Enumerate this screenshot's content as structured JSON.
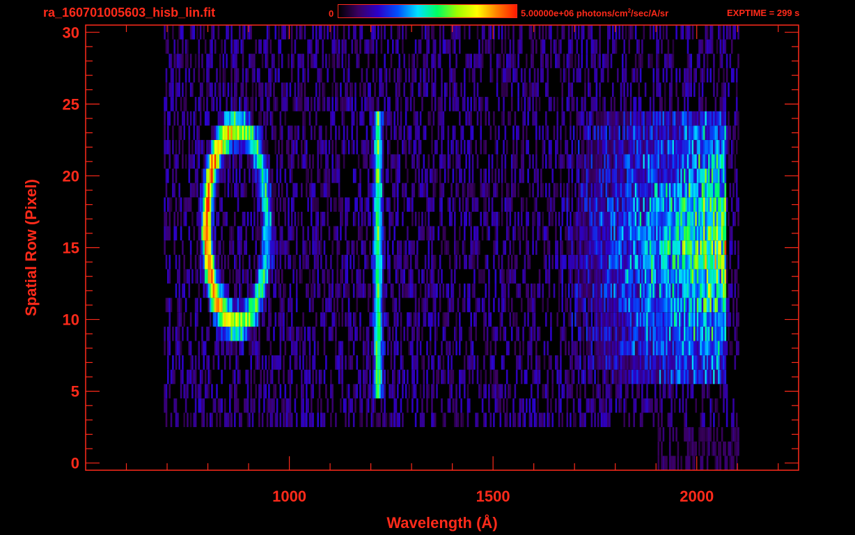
{
  "header": {
    "file_name": "ra_160701005603_hisb_lin.fit",
    "colorbar_min": "0",
    "colorbar_max_prefix": "5.00000e+06 photons/cm",
    "colorbar_max_sup": "2",
    "colorbar_max_suffix": "/sec/A/sr",
    "exptime": "EXPTIME = 299 s"
  },
  "colors": {
    "axis": "#ff2a1a",
    "background": "#000000",
    "colormap": [
      "#000000",
      "#3a0060",
      "#2c00c8",
      "#0050ff",
      "#00e0ff",
      "#00ff60",
      "#a0ff00",
      "#ffff00",
      "#ff8000",
      "#ff1a00"
    ]
  },
  "chart_data": {
    "type": "heatmap",
    "title": "",
    "xlabel": "Wavelength (Å)",
    "ylabel": "Spatial Row (Pixel)",
    "xlim": [
      500,
      2250
    ],
    "ylim": [
      -0.5,
      30.5
    ],
    "x_ticks": [
      1000,
      1500,
      2000
    ],
    "y_ticks": [
      0,
      5,
      10,
      15,
      20,
      25,
      30
    ],
    "colorbar_range": [
      0,
      5000000
    ],
    "colorbar_units": "photons/cm^2/sec/A/sr",
    "features": [
      {
        "kind": "ring",
        "center_x": 870,
        "center_y": 16.5,
        "radius_x": 75,
        "radius_y": 6.8,
        "peak": 0.85
      },
      {
        "kind": "line",
        "x": 1216,
        "y_from": 5,
        "y_to": 24,
        "peak": 0.5
      },
      {
        "kind": "continuum",
        "x_from": 1650,
        "x_to": 2070,
        "y_from": 6,
        "y_to": 24,
        "peak": 0.6
      },
      {
        "kind": "noise",
        "x_from": 690,
        "x_to": 2100,
        "y_from": 3,
        "y_to": 30,
        "level": 0.18
      }
    ]
  }
}
